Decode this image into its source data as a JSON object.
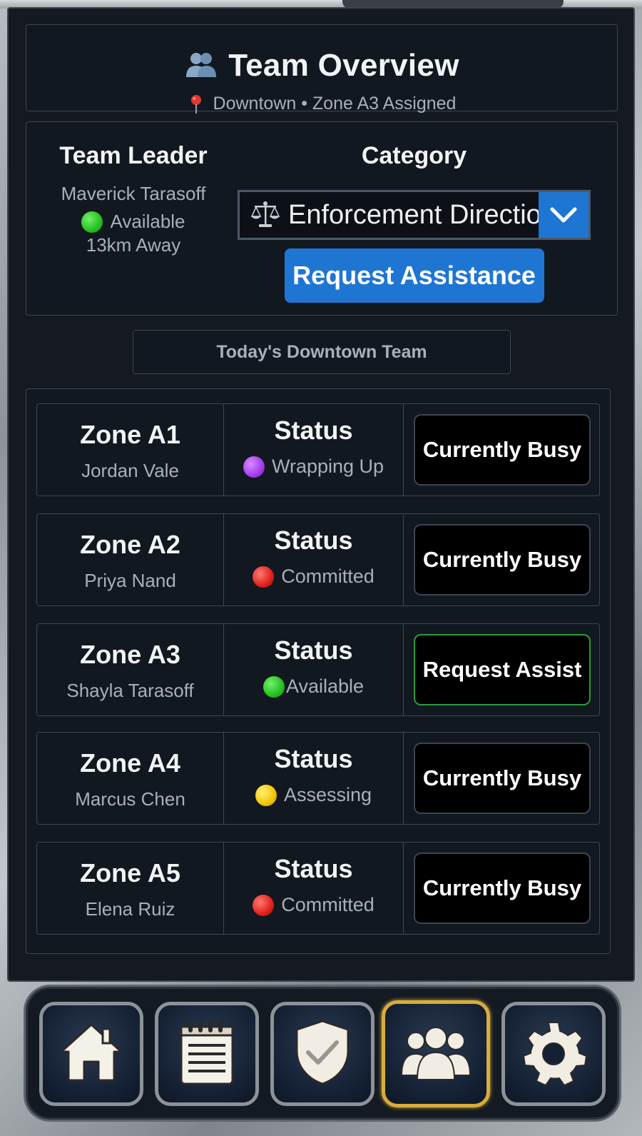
{
  "header": {
    "title": "Team Overview",
    "location": "Downtown • Zone A3 Assigned"
  },
  "leader": {
    "heading": "Team Leader",
    "name": "Maverick Tarasoff",
    "status": "Available",
    "distance": "13km Away"
  },
  "category": {
    "heading": "Category",
    "selected": "Enforcement Direction",
    "request_button": "Request Assistance"
  },
  "team_label": "Today's Downtown Team",
  "status_heading": "Status",
  "zones": [
    {
      "zone": "Zone A1",
      "member": "Jordan Vale",
      "status": "Wrapping Up",
      "status_color": "#a43cf0",
      "action": "Currently Busy"
    },
    {
      "zone": "Zone A2",
      "member": "Priya Nand",
      "status": "Committed",
      "status_color": "#e0211c",
      "action": "Currently Busy"
    },
    {
      "zone": "Zone A3",
      "member": "Shayla Tarasoff",
      "status": "Available",
      "status_color": "#26c022",
      "action": "Request Assist"
    },
    {
      "zone": "Zone A4",
      "member": "Marcus Chen",
      "status": "Assessing",
      "status_color": "#f5c400",
      "action": "Currently Busy"
    },
    {
      "zone": "Zone A5",
      "member": "Elena Ruiz",
      "status": "Committed",
      "status_color": "#e0211c",
      "action": "Currently Busy"
    }
  ],
  "nav": {
    "items": [
      "home-icon",
      "notepad-icon",
      "shield-check-icon",
      "team-icon",
      "gear-icon"
    ],
    "active": "team-icon"
  },
  "colors": {
    "accent": "#1f76d2",
    "available": "#26c022",
    "active_nav": "#d8ad3d"
  }
}
